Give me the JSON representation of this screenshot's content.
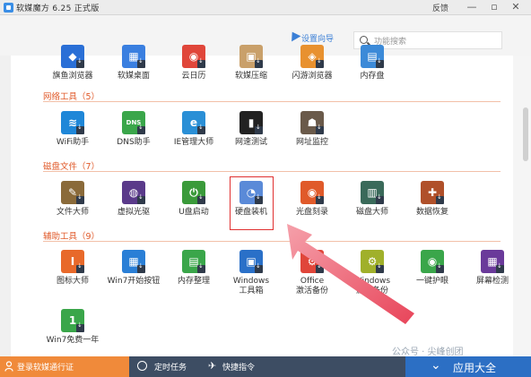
{
  "window": {
    "title": "软媒魔方 6.25 正式版",
    "feedback": "反馈",
    "min": "—",
    "max": "▫",
    "close": "✕"
  },
  "toolbar": {
    "guide_label": "设置向导",
    "search_placeholder": "功能搜索"
  },
  "top_row": {
    "items": [
      {
        "label": "旗鱼浏览器",
        "color": "#2a6fd6",
        "glyph": "◆"
      },
      {
        "label": "软媒桌面",
        "color": "#3a7fe0",
        "glyph": "▦"
      },
      {
        "label": "云日历",
        "color": "#e0463a",
        "glyph": "◉"
      },
      {
        "label": "软媒压缩",
        "color": "#c9a06a",
        "glyph": "▣"
      },
      {
        "label": "闪游浏览器",
        "color": "#e8912f",
        "glyph": "◈"
      },
      {
        "label": "内存盘",
        "color": "#3c8ad8",
        "glyph": "▤"
      }
    ]
  },
  "sections": [
    {
      "title": "网络工具（5）",
      "items": [
        {
          "label": "WiFi助手",
          "color": "#1f87d8",
          "glyph": "≋"
        },
        {
          "label": "DNS助手",
          "color": "#3aa64a",
          "glyph": "DNS"
        },
        {
          "label": "IE管理大师",
          "color": "#2a8fd6",
          "glyph": "e"
        },
        {
          "label": "网速测试",
          "color": "#222222",
          "glyph": "▮"
        },
        {
          "label": "网址监控",
          "color": "#6a5a4a",
          "glyph": "☗"
        }
      ]
    },
    {
      "title": "磁盘文件（7）",
      "items": [
        {
          "label": "文件大师",
          "color": "#8a6a3a",
          "glyph": "✎"
        },
        {
          "label": "虚拟光驱",
          "color": "#5a3a8a",
          "glyph": "◍"
        },
        {
          "label": "U盘启动",
          "color": "#3a9a3a",
          "glyph": "⏻"
        },
        {
          "label": "硬盘装机",
          "color": "#5a8ad8",
          "glyph": "◔"
        },
        {
          "label": "光盘刻录",
          "color": "#e05a2a",
          "glyph": "◉"
        },
        {
          "label": "磁盘大师",
          "color": "#3a6a5a",
          "glyph": "▥"
        },
        {
          "label": "数据恢复",
          "color": "#b0502a",
          "glyph": "✚"
        }
      ]
    },
    {
      "title": "辅助工具（9）",
      "items": [
        {
          "label": "图标大师",
          "color": "#e8692a",
          "glyph": "I"
        },
        {
          "label": "Win7开始按钮",
          "color": "#2a7fd6",
          "glyph": "▦"
        },
        {
          "label": "内存整理",
          "color": "#3aa64a",
          "glyph": "▤"
        },
        {
          "label": "Windows\n工具箱",
          "color": "#2a70c8",
          "glyph": "▣"
        },
        {
          "label": "Office\n激活备份",
          "color": "#e0463a",
          "glyph": "⚙"
        },
        {
          "label": "Windows\n激活备份",
          "color": "#a0b02a",
          "glyph": "⚙"
        },
        {
          "label": "一键护眼",
          "color": "#3aa64a",
          "glyph": "◉"
        },
        {
          "label": "屏幕检测",
          "color": "#6a3a9a",
          "glyph": "▦"
        },
        {
          "label": "Win7免费一年",
          "color": "#3aa64a",
          "glyph": "1"
        }
      ]
    }
  ],
  "watermark": "公众号 · 尖峰创团",
  "bottom": {
    "login": "登录软媒通行证",
    "tasks": "定时任务",
    "shortcuts": "快捷指令",
    "all_apps": "应用大全"
  },
  "colors": {
    "accent": "#2c6fc4",
    "section": "#e05a2a",
    "highlight": "#e03030",
    "arrow": "#e8455a"
  }
}
